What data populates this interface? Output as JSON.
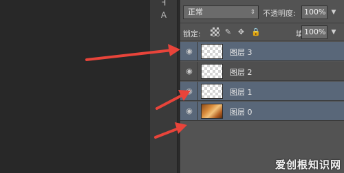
{
  "options": {
    "blend_mode": "正常",
    "opacity_label": "不透明度:",
    "opacity_value": "100%",
    "lock_label": "锁定:",
    "fill_label": "填充:",
    "fill_value": "100%"
  },
  "layers": [
    {
      "name": "图层 3",
      "selected": true,
      "thumb": "transparent"
    },
    {
      "name": "图层 2",
      "selected": false,
      "thumb": "transparent"
    },
    {
      "name": "图层 1",
      "selected": true,
      "thumb": "transparent"
    },
    {
      "name": "图层 0",
      "selected": true,
      "thumb": "photo"
    }
  ],
  "icons": {
    "visibility": "eye-icon",
    "lock_transparent": "checkerboard-lock-icon",
    "lock_paint": "brush-icon",
    "lock_move": "move-icon",
    "lock_all": "padlock-icon",
    "dropdown": "chevron-down-icon"
  },
  "annotation_color": "#e8443a",
  "watermark": "爱创根知识网"
}
